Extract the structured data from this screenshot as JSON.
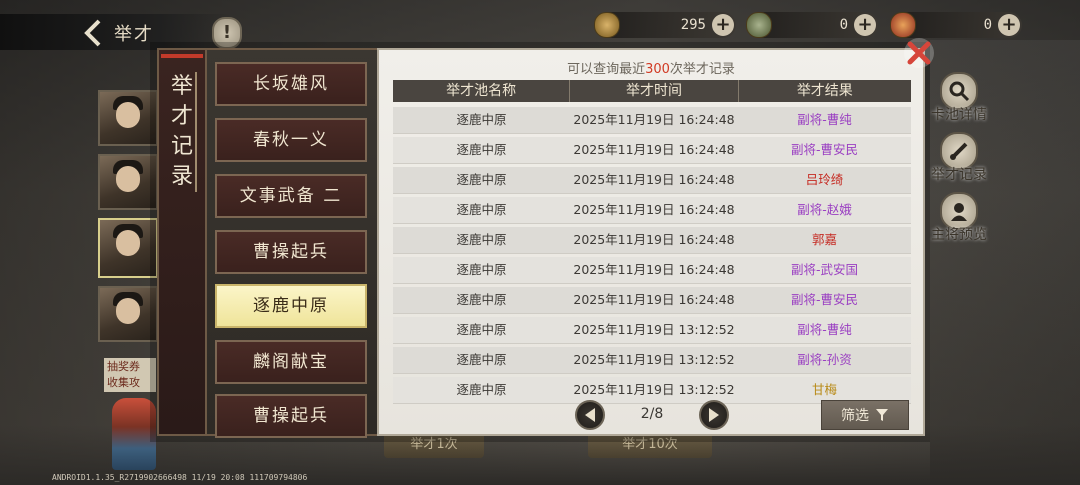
{
  "topbar": {
    "back_label": "举才",
    "info_label": "!",
    "resources": [
      {
        "icon": "coin-icon",
        "value": "295",
        "add": "+"
      },
      {
        "icon": "jade-icon",
        "value": "0",
        "add": "+"
      },
      {
        "icon": "token-icon",
        "value": "0",
        "add": "+"
      }
    ]
  },
  "left_panel": {
    "draw_tag": "抽奖券\n收集攻",
    "build_info": "ANDROID1.1.35_R2719902666498 11/19 20:08 111709794806"
  },
  "bottom_buttons": [
    "举才1次",
    "举才10次"
  ],
  "side_menu": [
    {
      "icon": "magnifier-icon",
      "label": "卡池详情"
    },
    {
      "icon": "brush-icon",
      "label": "举才记录"
    },
    {
      "icon": "hero-preview-icon",
      "label": "主将预览"
    }
  ],
  "modal": {
    "vertical_title": "举才记录",
    "categories": [
      "长坂雄风",
      "春秋一义",
      "文事武备 二",
      "曹操起兵",
      "逐鹿中原",
      "麟阁献宝",
      "曹操起兵"
    ],
    "active_category_index": 4,
    "notice": {
      "prefix": "可以查询最近",
      "highlight": "300",
      "suffix": "次举才记录"
    },
    "columns": [
      "举才池名称",
      "举才时间",
      "举才结果"
    ],
    "rows": [
      {
        "pool": "逐鹿中原",
        "time": "2025年11月19日 16:24:48",
        "result": "副将-曹纯",
        "quality": "purple"
      },
      {
        "pool": "逐鹿中原",
        "time": "2025年11月19日 16:24:48",
        "result": "副将-曹安民",
        "quality": "purple"
      },
      {
        "pool": "逐鹿中原",
        "time": "2025年11月19日 16:24:48",
        "result": "吕玲绮",
        "quality": "red"
      },
      {
        "pool": "逐鹿中原",
        "time": "2025年11月19日 16:24:48",
        "result": "副将-赵娥",
        "quality": "purple"
      },
      {
        "pool": "逐鹿中原",
        "time": "2025年11月19日 16:24:48",
        "result": "郭嘉",
        "quality": "red"
      },
      {
        "pool": "逐鹿中原",
        "time": "2025年11月19日 16:24:48",
        "result": "副将-武安国",
        "quality": "purple"
      },
      {
        "pool": "逐鹿中原",
        "time": "2025年11月19日 16:24:48",
        "result": "副将-曹安民",
        "quality": "purple"
      },
      {
        "pool": "逐鹿中原",
        "time": "2025年11月19日 13:12:52",
        "result": "副将-曹纯",
        "quality": "purple"
      },
      {
        "pool": "逐鹿中原",
        "time": "2025年11月19日 13:12:52",
        "result": "副将-孙资",
        "quality": "purple"
      },
      {
        "pool": "逐鹿中原",
        "time": "2025年11月19日 13:12:52",
        "result": "甘梅",
        "quality": "gold"
      }
    ],
    "pager": {
      "page": "2/8"
    },
    "filter_label": "筛选"
  },
  "colors": {
    "purple": "#9a3fc2",
    "red": "#c52a22",
    "gold": "#b88a16",
    "highlight": "#d13a24",
    "close": "#d6453a"
  }
}
